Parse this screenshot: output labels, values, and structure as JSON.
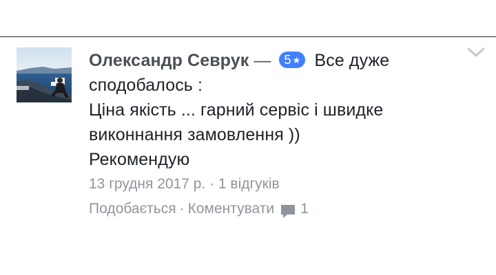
{
  "review": {
    "author": "Олександр Севрук",
    "separator": "—",
    "rating": "5",
    "rating_star": "★",
    "text_line1": "Все дуже",
    "text_line2": "сподобалось :",
    "text_line3": "Ціна якість ... гарний сервіс і швидке",
    "text_line4": "виконнання замовлення ))",
    "text_line5": "Рекомендую",
    "date": "13 грудня 2017 р.",
    "meta_sep": "·",
    "review_count": "1 відгуків"
  },
  "actions": {
    "like": "Подобається",
    "sep": "·",
    "comment": "Коментувати",
    "comment_count": "1"
  },
  "icons": {
    "options": "chevron-down-icon",
    "comment": "comment-bubble-icon",
    "rating": "star-icon"
  },
  "colors": {
    "badge": "#4080ff",
    "author": "#4b4f56",
    "text": "#1d2129",
    "muted": "#90949c"
  }
}
